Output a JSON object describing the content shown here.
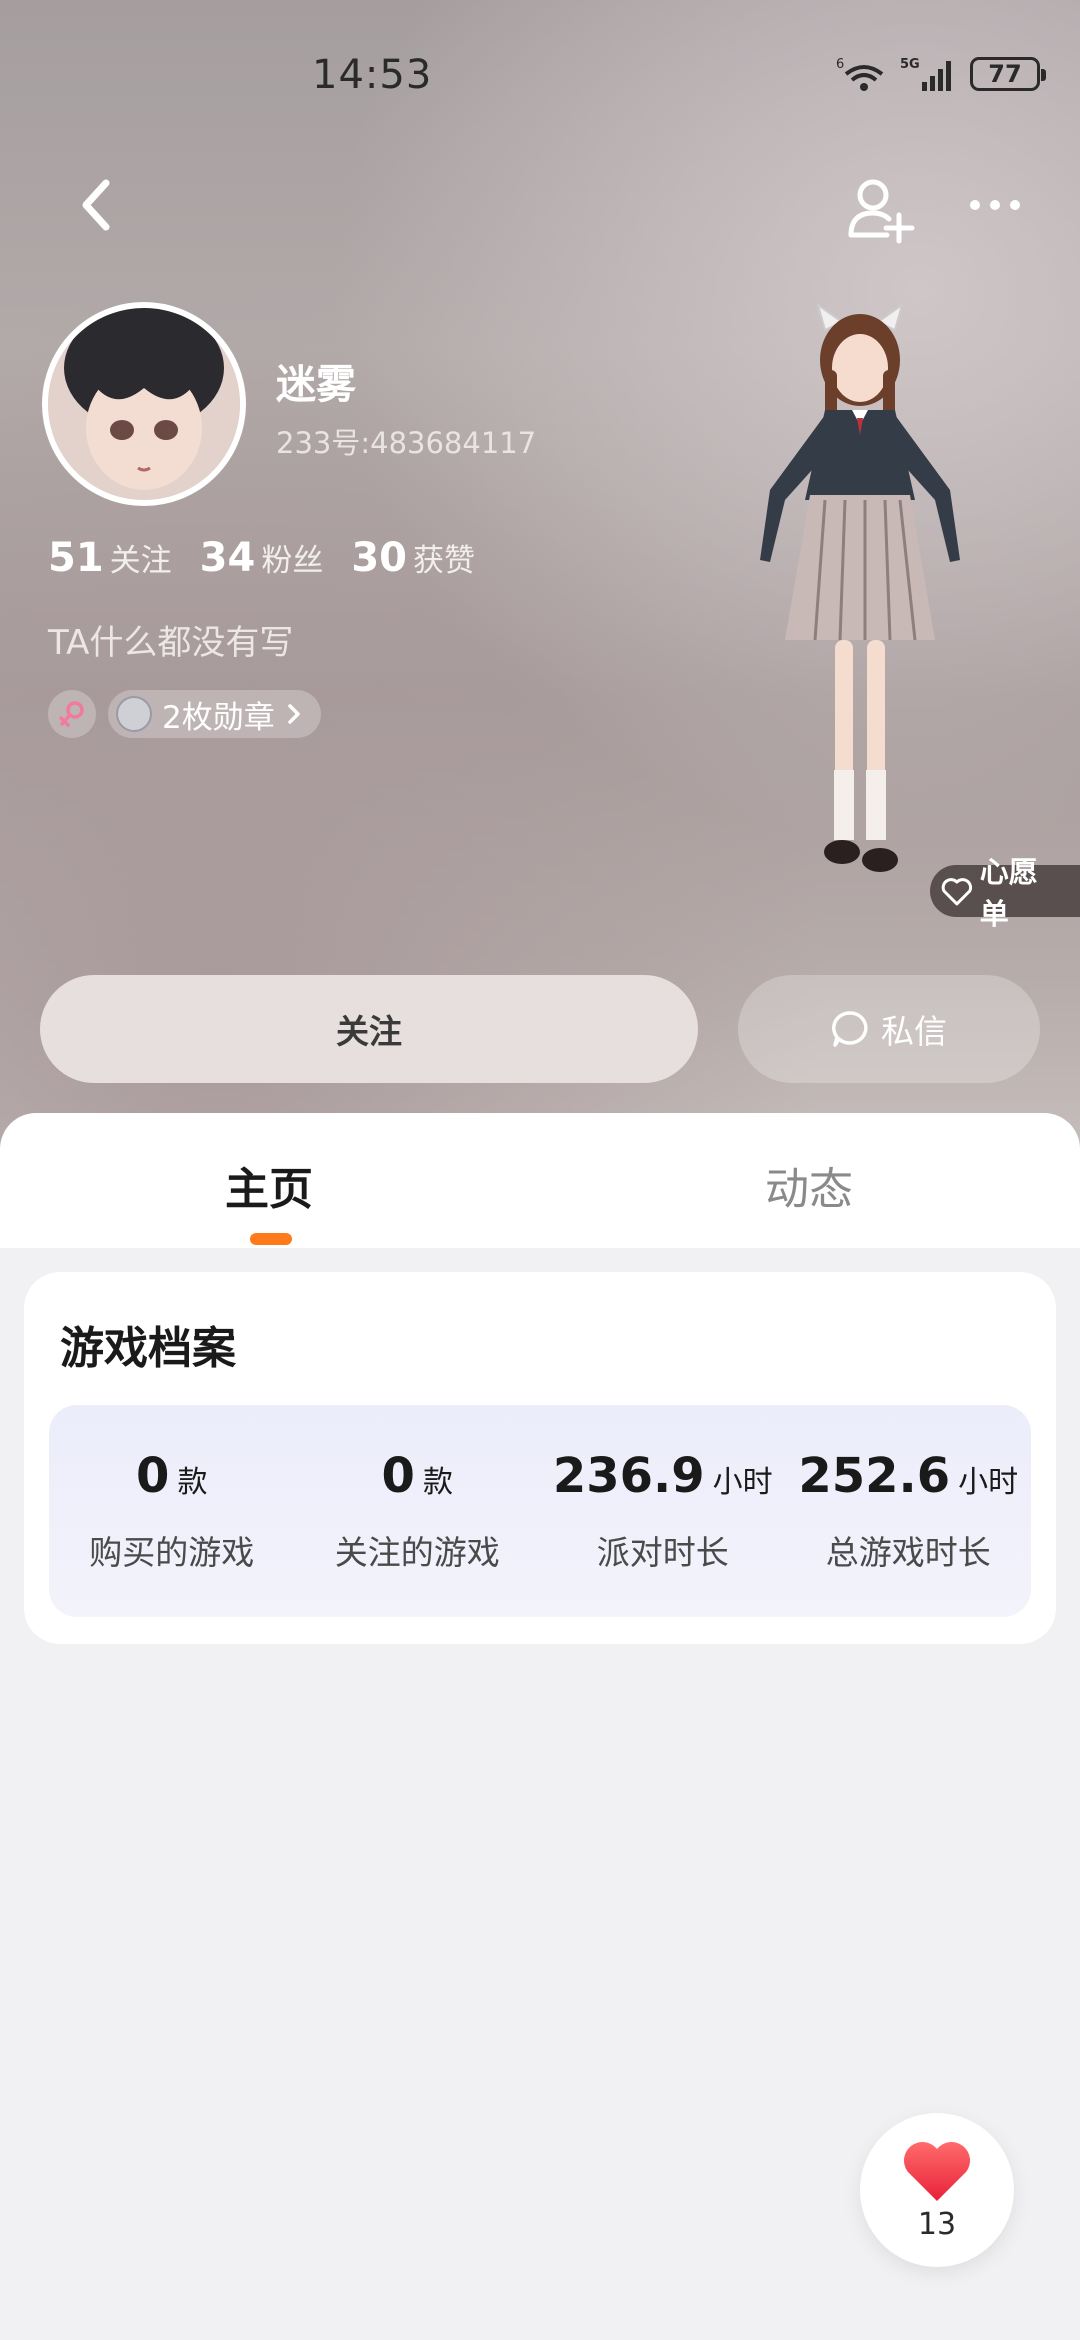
{
  "status_bar": {
    "time": "14:53",
    "battery": "77",
    "signal_label": "5G",
    "wifi_label": "6"
  },
  "profile": {
    "username": "迷雾",
    "uid": "233号:483684117",
    "stats": [
      {
        "num": "51",
        "label": "关注"
      },
      {
        "num": "34",
        "label": "粉丝"
      },
      {
        "num": "30",
        "label": "获赞"
      }
    ],
    "bio": "TA什么都没有写",
    "medal_label": "2枚勋章",
    "gender": "female",
    "wishlist_label": "心愿单"
  },
  "actions": {
    "follow_label": "关注",
    "dm_label": "私信"
  },
  "tabs": [
    {
      "label": "主页",
      "active": true
    },
    {
      "label": "动态",
      "active": false
    }
  ],
  "game_profile": {
    "title": "游戏档案",
    "items": [
      {
        "value": "0",
        "unit": "款",
        "label": "购买的游戏"
      },
      {
        "value": "0",
        "unit": "款",
        "label": "关注的游戏"
      },
      {
        "value": "236.9",
        "unit": "小时",
        "label": "派对时长"
      },
      {
        "value": "252.6",
        "unit": "小时",
        "label": "总游戏时长"
      }
    ]
  },
  "like_fab": {
    "count": "13"
  },
  "colors": {
    "accent": "#ff7a1a",
    "heart": "#f0394a"
  }
}
